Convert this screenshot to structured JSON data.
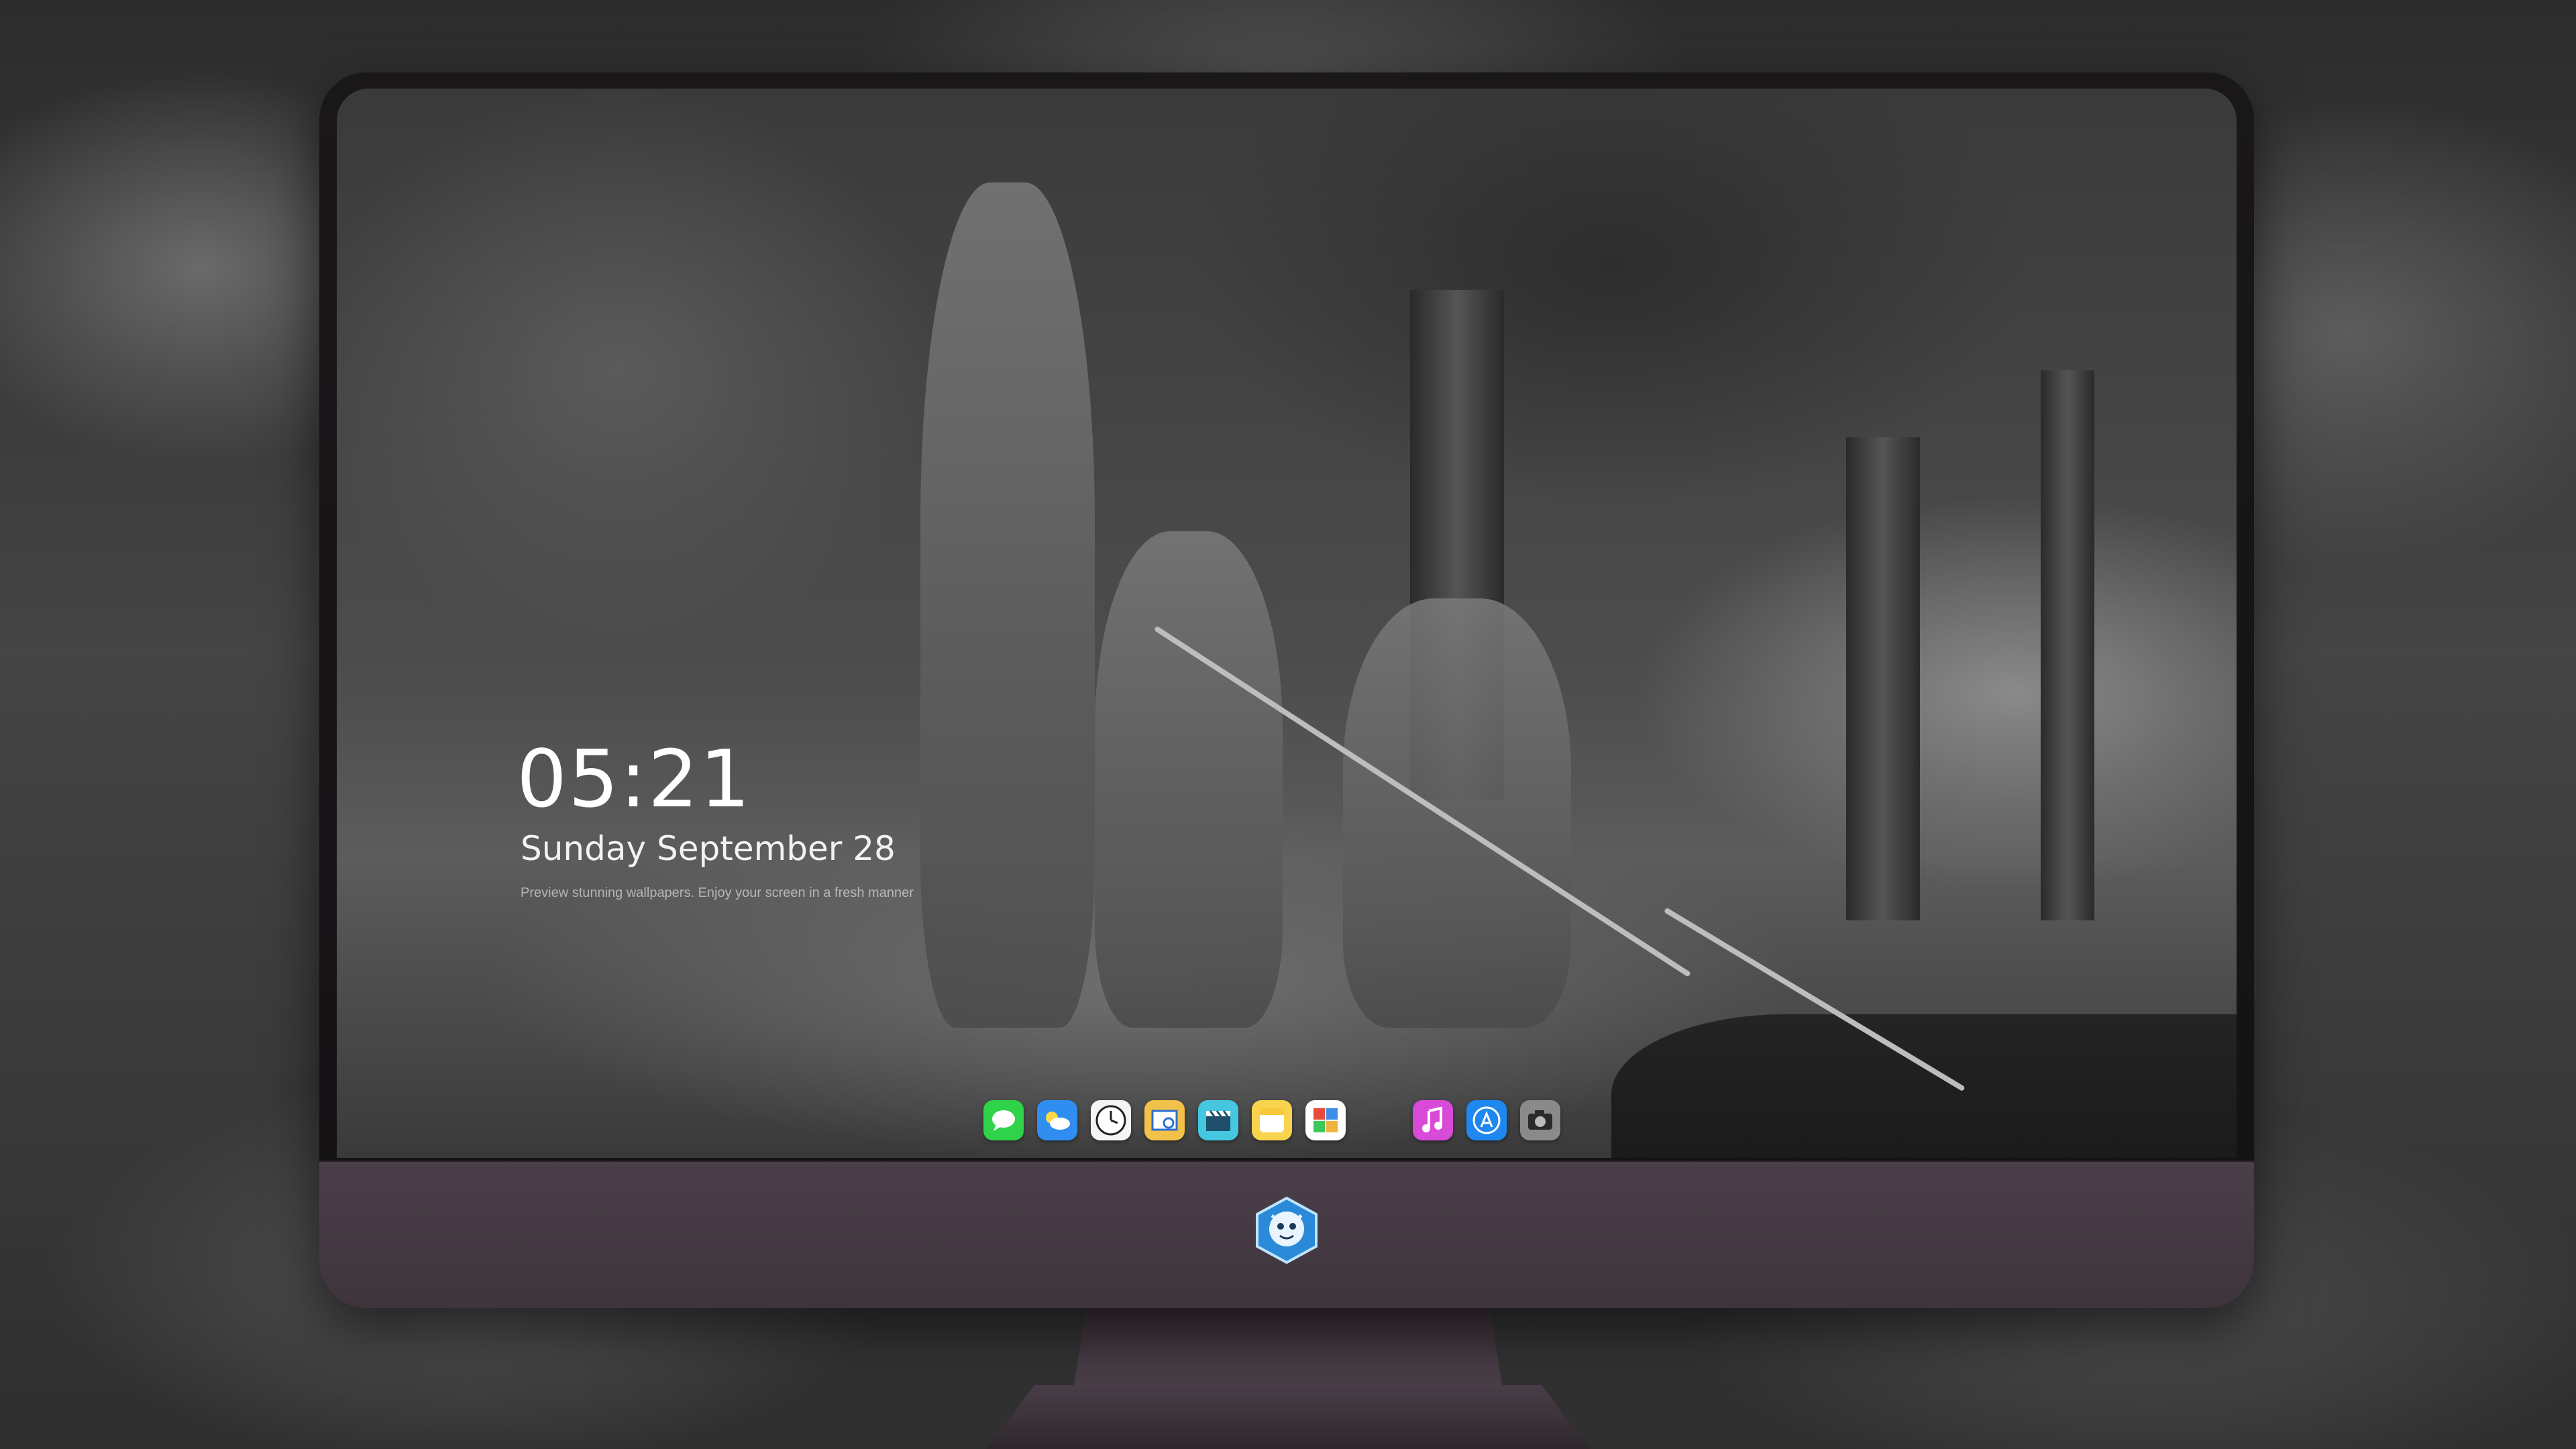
{
  "lockscreen": {
    "time": "05:21",
    "date": "Sunday September  28",
    "subtext": "Preview stunning wallpapers. Enjoy your screen in a fresh manner"
  },
  "dock": {
    "items": [
      {
        "name": "messages-icon",
        "color": "#2fd34a"
      },
      {
        "name": "weather-icon",
        "color": "#2f8ef0"
      },
      {
        "name": "clock-icon",
        "color": "#f4f4f4"
      },
      {
        "name": "preview-icon",
        "color": "#f0c24a"
      },
      {
        "name": "video-clapper-icon",
        "color": "#46c7e0"
      },
      {
        "name": "notes-icon",
        "color": "#f7d34e"
      },
      {
        "name": "photo-collage-icon",
        "color": "#e84b3c"
      },
      {
        "name": "music-icon",
        "color": "#d84ad8"
      },
      {
        "name": "app-store-icon",
        "color": "#1f88f0"
      },
      {
        "name": "camera-icon",
        "color": "#8a8a8a"
      }
    ]
  },
  "monitor": {
    "logo_name": "mascot-logo-icon",
    "accent": "#4b3f49"
  }
}
